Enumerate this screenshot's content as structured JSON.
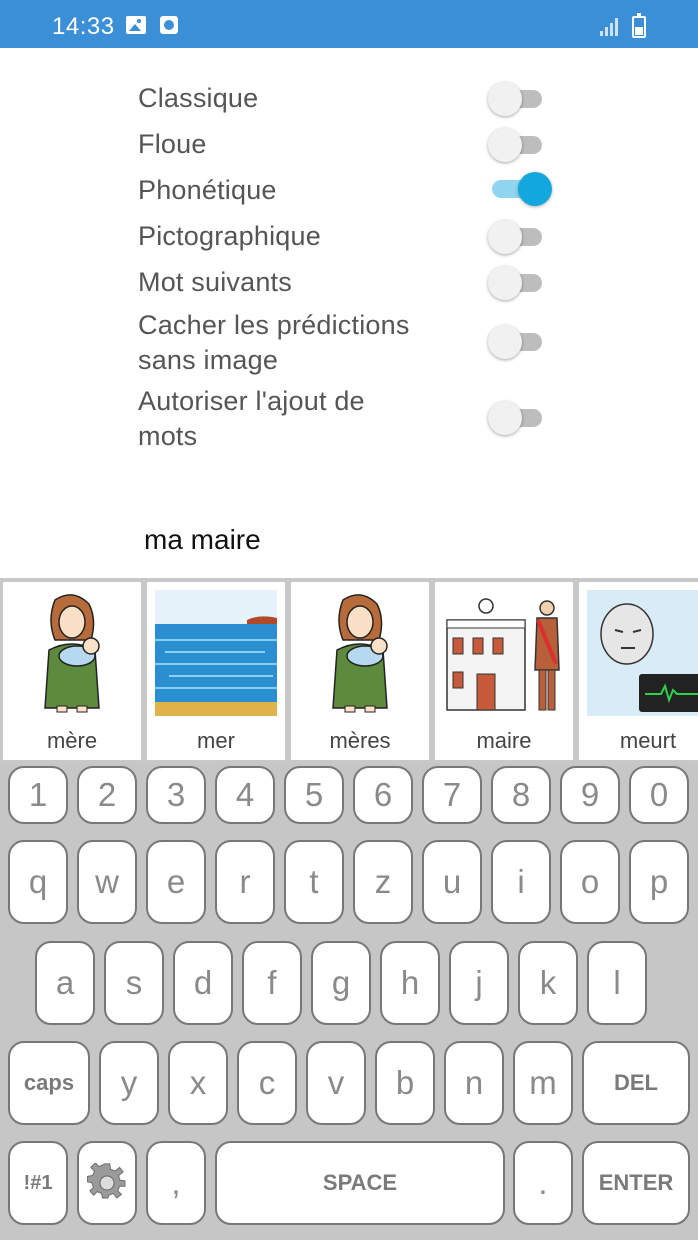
{
  "status_bar": {
    "time": "14:33",
    "icons": [
      "image-icon",
      "app-notification-icon",
      "signal-icon",
      "battery-charging-icon"
    ]
  },
  "settings": [
    {
      "label": "Classique",
      "enabled": false
    },
    {
      "label": "Floue",
      "enabled": false
    },
    {
      "label": "Phonétique",
      "enabled": true
    },
    {
      "label": "Pictographique",
      "enabled": false
    },
    {
      "label": "Mot suivants",
      "enabled": false
    },
    {
      "label_line1": "Cacher les prédictions",
      "label_line2": "sans image",
      "enabled": false
    },
    {
      "label_line1": "Autoriser l'ajout de",
      "label_line2": "mots",
      "enabled": false
    }
  ],
  "typed_text": "ma maire",
  "predictions": [
    {
      "word": "mère",
      "picture": "mother-holding-baby"
    },
    {
      "word": "mer",
      "picture": "sea-beach"
    },
    {
      "word": "mères",
      "picture": "mother-holding-baby"
    },
    {
      "word": "maire",
      "picture": "mayor-with-town-hall"
    },
    {
      "word": "meurt",
      "picture": "person-in-hospital-bed"
    }
  ],
  "keyboard": {
    "row_numbers": [
      "1",
      "2",
      "3",
      "4",
      "5",
      "6",
      "7",
      "8",
      "9",
      "0"
    ],
    "row_top": [
      "q",
      "w",
      "e",
      "r",
      "t",
      "z",
      "u",
      "i",
      "o",
      "p"
    ],
    "row_middle": [
      "a",
      "s",
      "d",
      "f",
      "g",
      "h",
      "j",
      "k",
      "l"
    ],
    "row_bottom": [
      "caps",
      "y",
      "x",
      "c",
      "v",
      "b",
      "n",
      "m",
      "DEL"
    ],
    "row_function": [
      "!#1",
      "settings-gear",
      ",",
      "SPACE",
      ".",
      "ENTER"
    ]
  },
  "colors": {
    "status_bar": "#3b8fd6",
    "toggle_on": "#12a8df",
    "keyboard_bg": "#c6c6c6"
  }
}
